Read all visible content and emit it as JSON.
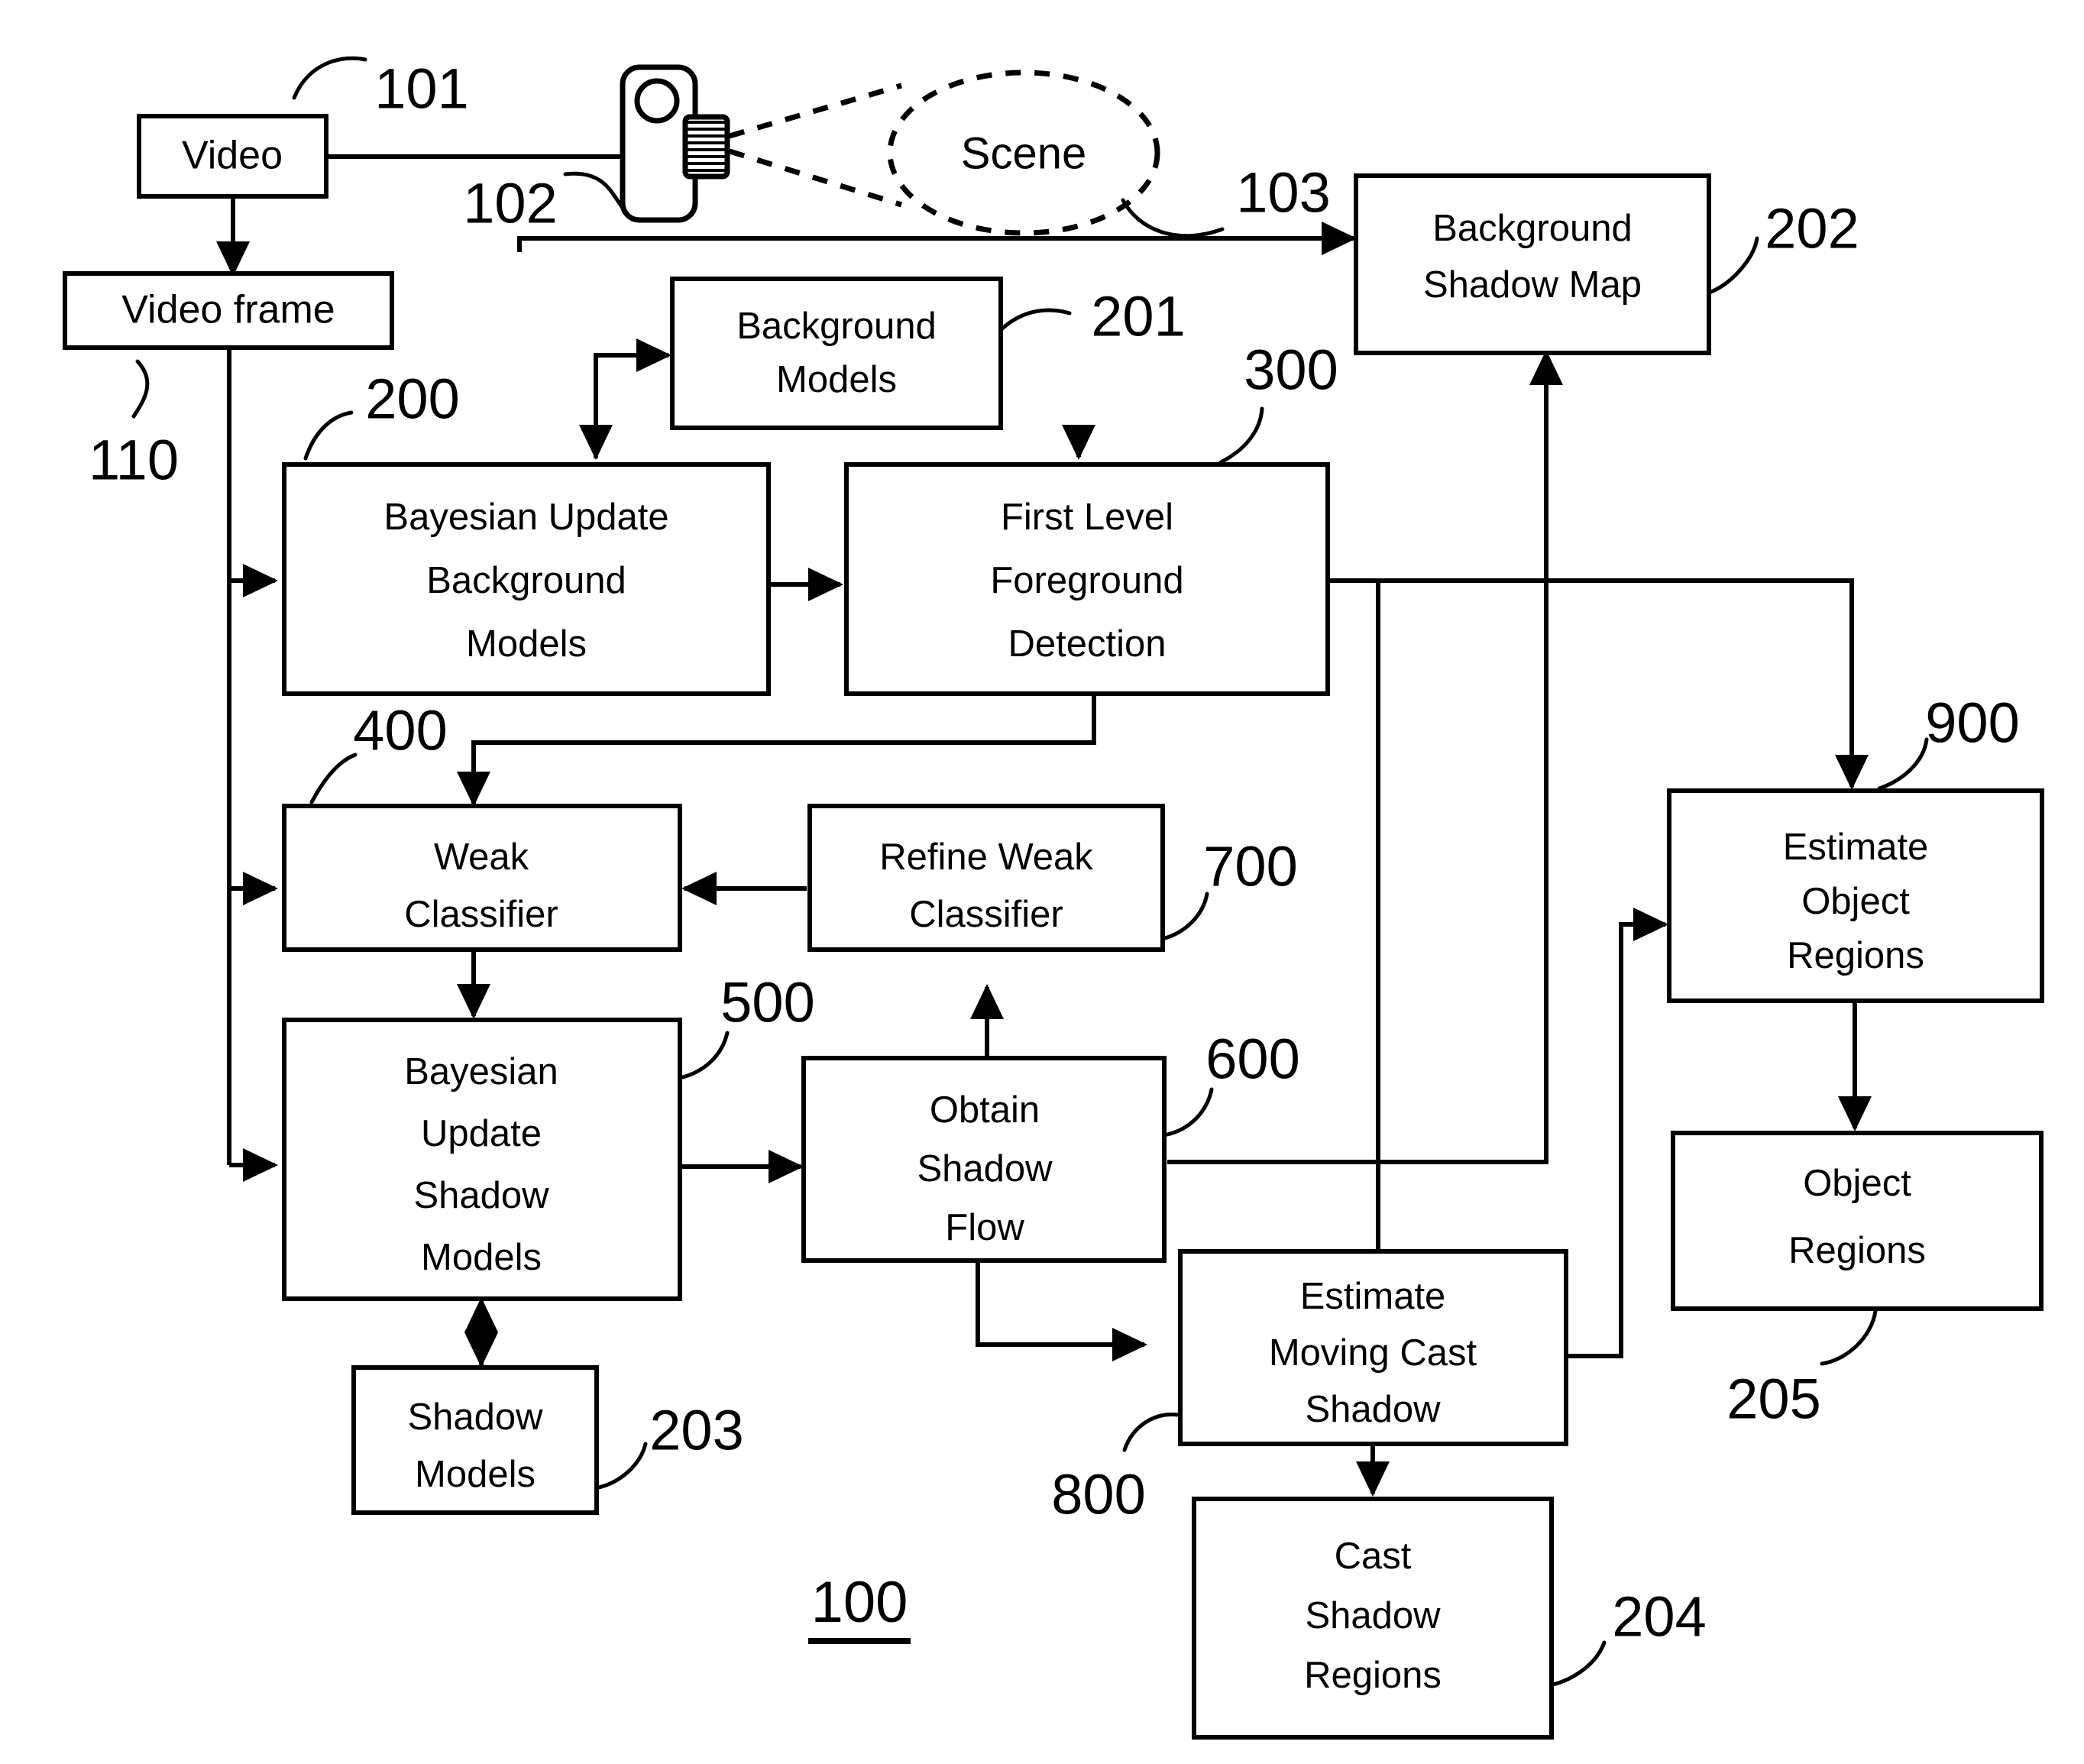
{
  "figure": {
    "figure_number": "100",
    "scene_label": "Scene"
  },
  "boxes": {
    "video": {
      "lines": [
        "Video"
      ]
    },
    "video_frame": {
      "lines": [
        "Video frame"
      ]
    },
    "background_models": {
      "lines": [
        "Background",
        "Models"
      ]
    },
    "background_shadow_map": {
      "lines": [
        "Background",
        "Shadow Map"
      ]
    },
    "bayesian_update_background_models": {
      "lines": [
        "Bayesian Update",
        "Background",
        "Models"
      ]
    },
    "first_level_foreground_detection": {
      "lines": [
        "First Level",
        "Foreground",
        "Detection"
      ]
    },
    "weak_classifier": {
      "lines": [
        "Weak",
        "Classifier"
      ]
    },
    "refine_weak_classifier": {
      "lines": [
        "Refine Weak",
        "Classifier"
      ]
    },
    "bayesian_update_shadow_models": {
      "lines": [
        "Bayesian",
        "Update",
        "Shadow",
        "Models"
      ]
    },
    "obtain_shadow_flow": {
      "lines": [
        "Obtain",
        "Shadow",
        "Flow"
      ]
    },
    "shadow_models": {
      "lines": [
        "Shadow",
        "Models"
      ]
    },
    "estimate_moving_cast_shadow": {
      "lines": [
        "Estimate",
        "Moving Cast",
        "Shadow"
      ]
    },
    "cast_shadow_regions": {
      "lines": [
        "Cast",
        "Shadow",
        "Regions"
      ]
    },
    "estimate_object_regions": {
      "lines": [
        "Estimate",
        "Object",
        "Regions"
      ]
    },
    "object_regions": {
      "lines": [
        "Object",
        "Regions"
      ]
    }
  },
  "reference_numerals": {
    "video": "101",
    "camera": "102",
    "scene": "103",
    "video_frame": "110",
    "bayesian_update_background_models": "200",
    "background_models": "201",
    "background_shadow_map": "202",
    "shadow_models": "203",
    "cast_shadow_regions": "204",
    "object_regions": "205",
    "first_level_foreground_detection": "300",
    "weak_classifier": "400",
    "bayesian_update_shadow_models": "500",
    "obtain_shadow_flow": "600",
    "refine_weak_classifier": "700",
    "estimate_moving_cast_shadow": "800",
    "estimate_object_regions": "900"
  },
  "icons": {
    "camera": "video-camera-icon",
    "scene": "scene-ellipse-icon"
  },
  "colors": {
    "line": "#000000",
    "background": "#ffffff",
    "text": "#000000"
  }
}
